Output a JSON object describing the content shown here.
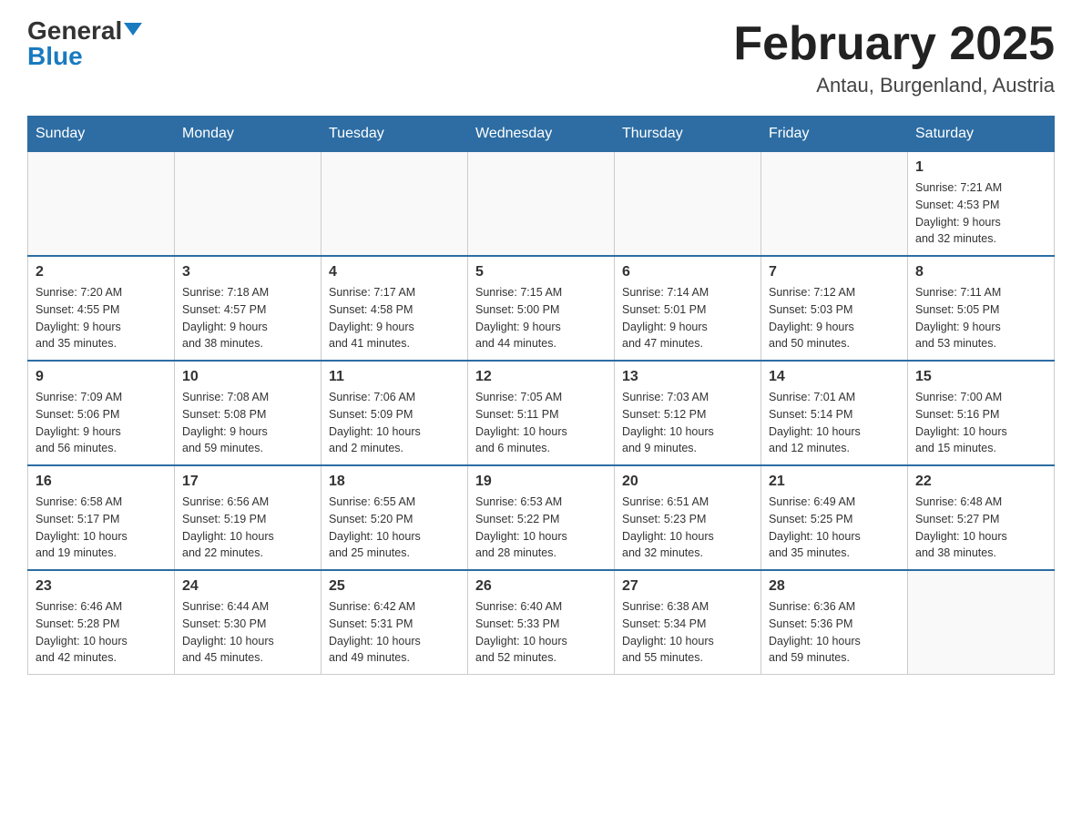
{
  "header": {
    "logo_general": "General",
    "logo_blue": "Blue",
    "month_title": "February 2025",
    "location": "Antau, Burgenland, Austria"
  },
  "weekdays": [
    "Sunday",
    "Monday",
    "Tuesday",
    "Wednesday",
    "Thursday",
    "Friday",
    "Saturday"
  ],
  "weeks": [
    [
      {
        "day": "",
        "info": ""
      },
      {
        "day": "",
        "info": ""
      },
      {
        "day": "",
        "info": ""
      },
      {
        "day": "",
        "info": ""
      },
      {
        "day": "",
        "info": ""
      },
      {
        "day": "",
        "info": ""
      },
      {
        "day": "1",
        "info": "Sunrise: 7:21 AM\nSunset: 4:53 PM\nDaylight: 9 hours\nand 32 minutes."
      }
    ],
    [
      {
        "day": "2",
        "info": "Sunrise: 7:20 AM\nSunset: 4:55 PM\nDaylight: 9 hours\nand 35 minutes."
      },
      {
        "day": "3",
        "info": "Sunrise: 7:18 AM\nSunset: 4:57 PM\nDaylight: 9 hours\nand 38 minutes."
      },
      {
        "day": "4",
        "info": "Sunrise: 7:17 AM\nSunset: 4:58 PM\nDaylight: 9 hours\nand 41 minutes."
      },
      {
        "day": "5",
        "info": "Sunrise: 7:15 AM\nSunset: 5:00 PM\nDaylight: 9 hours\nand 44 minutes."
      },
      {
        "day": "6",
        "info": "Sunrise: 7:14 AM\nSunset: 5:01 PM\nDaylight: 9 hours\nand 47 minutes."
      },
      {
        "day": "7",
        "info": "Sunrise: 7:12 AM\nSunset: 5:03 PM\nDaylight: 9 hours\nand 50 minutes."
      },
      {
        "day": "8",
        "info": "Sunrise: 7:11 AM\nSunset: 5:05 PM\nDaylight: 9 hours\nand 53 minutes."
      }
    ],
    [
      {
        "day": "9",
        "info": "Sunrise: 7:09 AM\nSunset: 5:06 PM\nDaylight: 9 hours\nand 56 minutes."
      },
      {
        "day": "10",
        "info": "Sunrise: 7:08 AM\nSunset: 5:08 PM\nDaylight: 9 hours\nand 59 minutes."
      },
      {
        "day": "11",
        "info": "Sunrise: 7:06 AM\nSunset: 5:09 PM\nDaylight: 10 hours\nand 2 minutes."
      },
      {
        "day": "12",
        "info": "Sunrise: 7:05 AM\nSunset: 5:11 PM\nDaylight: 10 hours\nand 6 minutes."
      },
      {
        "day": "13",
        "info": "Sunrise: 7:03 AM\nSunset: 5:12 PM\nDaylight: 10 hours\nand 9 minutes."
      },
      {
        "day": "14",
        "info": "Sunrise: 7:01 AM\nSunset: 5:14 PM\nDaylight: 10 hours\nand 12 minutes."
      },
      {
        "day": "15",
        "info": "Sunrise: 7:00 AM\nSunset: 5:16 PM\nDaylight: 10 hours\nand 15 minutes."
      }
    ],
    [
      {
        "day": "16",
        "info": "Sunrise: 6:58 AM\nSunset: 5:17 PM\nDaylight: 10 hours\nand 19 minutes."
      },
      {
        "day": "17",
        "info": "Sunrise: 6:56 AM\nSunset: 5:19 PM\nDaylight: 10 hours\nand 22 minutes."
      },
      {
        "day": "18",
        "info": "Sunrise: 6:55 AM\nSunset: 5:20 PM\nDaylight: 10 hours\nand 25 minutes."
      },
      {
        "day": "19",
        "info": "Sunrise: 6:53 AM\nSunset: 5:22 PM\nDaylight: 10 hours\nand 28 minutes."
      },
      {
        "day": "20",
        "info": "Sunrise: 6:51 AM\nSunset: 5:23 PM\nDaylight: 10 hours\nand 32 minutes."
      },
      {
        "day": "21",
        "info": "Sunrise: 6:49 AM\nSunset: 5:25 PM\nDaylight: 10 hours\nand 35 minutes."
      },
      {
        "day": "22",
        "info": "Sunrise: 6:48 AM\nSunset: 5:27 PM\nDaylight: 10 hours\nand 38 minutes."
      }
    ],
    [
      {
        "day": "23",
        "info": "Sunrise: 6:46 AM\nSunset: 5:28 PM\nDaylight: 10 hours\nand 42 minutes."
      },
      {
        "day": "24",
        "info": "Sunrise: 6:44 AM\nSunset: 5:30 PM\nDaylight: 10 hours\nand 45 minutes."
      },
      {
        "day": "25",
        "info": "Sunrise: 6:42 AM\nSunset: 5:31 PM\nDaylight: 10 hours\nand 49 minutes."
      },
      {
        "day": "26",
        "info": "Sunrise: 6:40 AM\nSunset: 5:33 PM\nDaylight: 10 hours\nand 52 minutes."
      },
      {
        "day": "27",
        "info": "Sunrise: 6:38 AM\nSunset: 5:34 PM\nDaylight: 10 hours\nand 55 minutes."
      },
      {
        "day": "28",
        "info": "Sunrise: 6:36 AM\nSunset: 5:36 PM\nDaylight: 10 hours\nand 59 minutes."
      },
      {
        "day": "",
        "info": ""
      }
    ]
  ]
}
